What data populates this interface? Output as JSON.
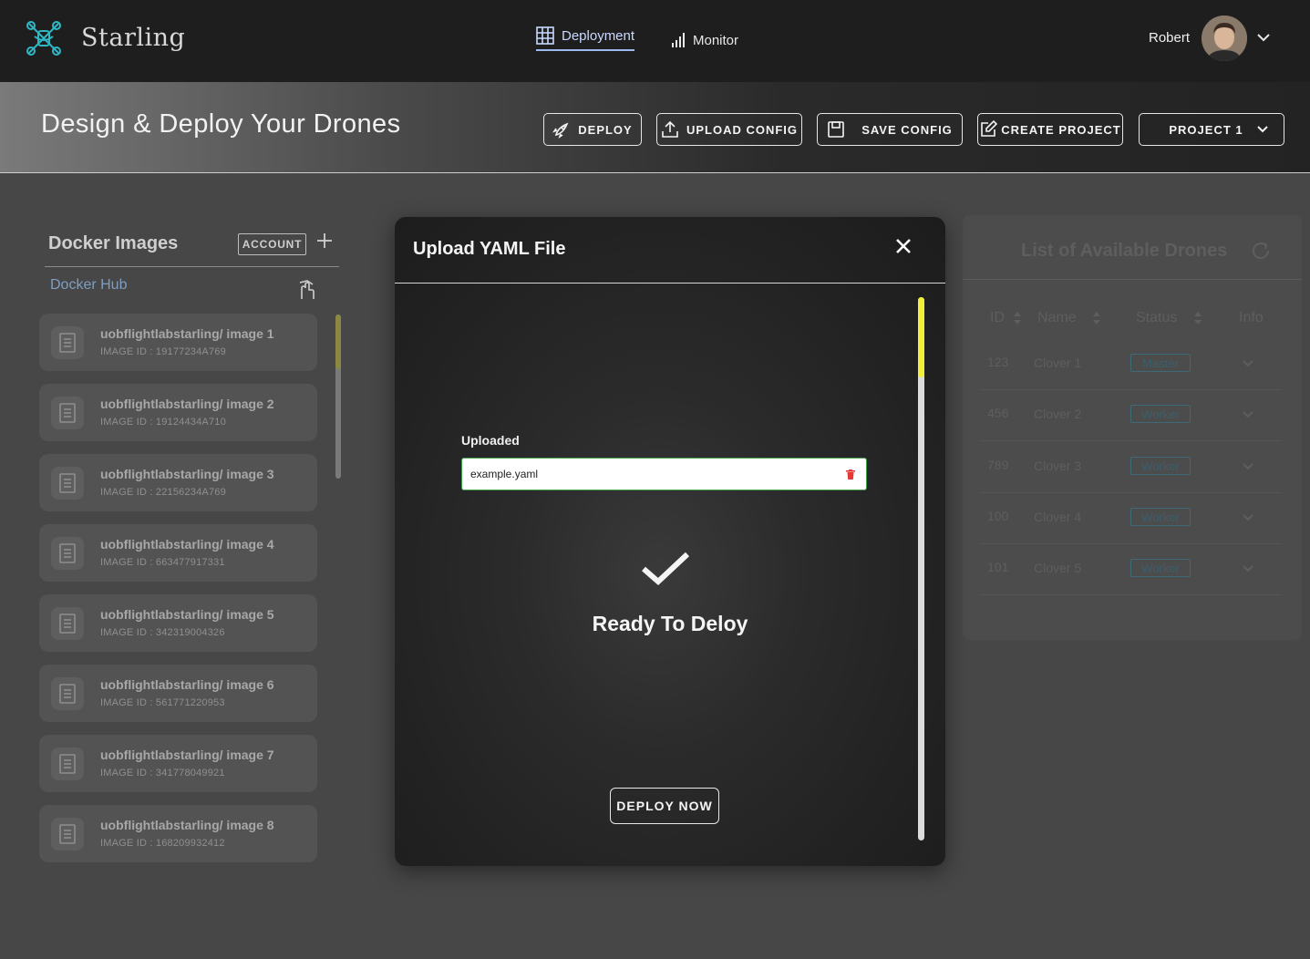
{
  "app": {
    "brand": "Starling"
  },
  "nav": {
    "deployment": "Deployment",
    "monitor": "Monitor",
    "user_name": "Robert"
  },
  "header": {
    "title": "Design & Deploy Your Drones",
    "buttons": {
      "deploy": "DEPLOY",
      "upload_config": "UPLOAD CONFIG",
      "save_config": "SAVE CONFIG",
      "create_project": "CREATE PROJECT",
      "project_select": "PROJECT 1"
    }
  },
  "docker": {
    "title": "Docker Images",
    "account_label": "ACCOUNT",
    "source": "Docker Hub",
    "images": [
      {
        "name": "uobflightlabstarling/ image 1",
        "id": "IMAGE ID : 19177234A769"
      },
      {
        "name": "uobflightlabstarling/ image 2",
        "id": "IMAGE ID : 19124434A710"
      },
      {
        "name": "uobflightlabstarling/ image 3",
        "id": "IMAGE ID : 22156234A769"
      },
      {
        "name": "uobflightlabstarling/ image 4",
        "id": "IMAGE ID : 663477917331"
      },
      {
        "name": "uobflightlabstarling/ image 5",
        "id": "IMAGE ID : 342319004326"
      },
      {
        "name": "uobflightlabstarling/ image 6",
        "id": "IMAGE ID : 561771220953"
      },
      {
        "name": "uobflightlabstarling/ image 7",
        "id": "IMAGE ID : 341778049921"
      },
      {
        "name": "uobflightlabstarling/ image 8",
        "id": "IMAGE ID : 168209932412"
      }
    ]
  },
  "drones": {
    "title": "List of Available Drones",
    "columns": {
      "id": "ID",
      "name": "Name",
      "status": "Status",
      "info": "Info"
    },
    "rows": [
      {
        "id": "123",
        "name": "Clover 1",
        "status": "Master"
      },
      {
        "id": "456",
        "name": "Clover 2",
        "status": "Worker"
      },
      {
        "id": "789",
        "name": "Clover 3",
        "status": "Worker"
      },
      {
        "id": "100",
        "name": "Clover 4",
        "status": "Worker"
      },
      {
        "id": "101",
        "name": "Clover 5",
        "status": "Worker"
      }
    ]
  },
  "modal": {
    "title": "Upload YAML File",
    "uploaded_label": "Uploaded",
    "file_name": "example.yaml",
    "status_text": "Ready To Deloy",
    "deploy_now": "DEPLOY NOW",
    "scroll_position": 0
  },
  "icons": {
    "logo": "drone-logo-icon",
    "deployment": "grid-icon",
    "monitor": "bar-chart-icon",
    "deploy": "rocket-icon",
    "upload": "upload-icon",
    "save": "floppy-icon",
    "create": "edit-icon",
    "refresh": "refresh-icon",
    "close": "close-icon",
    "trash": "trash-icon",
    "check": "check-icon"
  },
  "colors": {
    "accent_teal": "#2fb7c4",
    "scroll_thumb": "#f2ee3a",
    "field_border": "#3fa24a",
    "hub_link": "#7e9ec2"
  }
}
